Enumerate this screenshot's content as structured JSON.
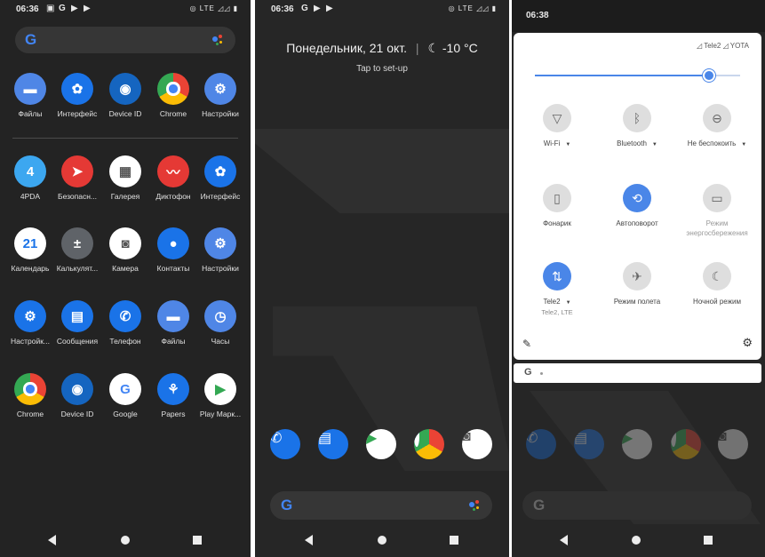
{
  "screen1": {
    "time": "06:36",
    "status_right": "LTE",
    "rows": [
      [
        {
          "label": "Файлы",
          "icon": "files-icon",
          "color": "#4f86e6"
        },
        {
          "label": "Интерфейс",
          "icon": "interface-icon",
          "color": "#1a73e8"
        },
        {
          "label": "Device ID",
          "icon": "device-id-icon",
          "color": "#1565c0"
        },
        {
          "label": "Chrome",
          "icon": "chrome-icon",
          "color": "#ffffff"
        },
        {
          "label": "Настройки",
          "icon": "settings-icon",
          "color": "#4f86e6"
        }
      ],
      [
        {
          "label": "4PDA",
          "icon": "4pda-icon",
          "color": "#3ca7f0"
        },
        {
          "label": "Безопасн...",
          "icon": "security-icon",
          "color": "#e53935"
        },
        {
          "label": "Галерея",
          "icon": "gallery-icon",
          "color": "#ffffff"
        },
        {
          "label": "Диктофон",
          "icon": "recorder-icon",
          "color": "#e53935"
        },
        {
          "label": "Интерфейс",
          "icon": "interface-icon",
          "color": "#1a73e8"
        }
      ],
      [
        {
          "label": "Календарь",
          "icon": "calendar-icon",
          "color": "#ffffff"
        },
        {
          "label": "Калькулят...",
          "icon": "calculator-icon",
          "color": "#5f6368"
        },
        {
          "label": "Камера",
          "icon": "camera-icon",
          "color": "#ffffff"
        },
        {
          "label": "Контакты",
          "icon": "contacts-icon",
          "color": "#1a73e8"
        },
        {
          "label": "Настройки",
          "icon": "settings-icon",
          "color": "#4f86e6"
        }
      ],
      [
        {
          "label": "Настройк...",
          "icon": "settings-icon",
          "color": "#1a73e8"
        },
        {
          "label": "Сообщения",
          "icon": "messages-icon",
          "color": "#1a73e8"
        },
        {
          "label": "Телефон",
          "icon": "phone-icon",
          "color": "#1a73e8"
        },
        {
          "label": "Файлы",
          "icon": "files-icon",
          "color": "#4f86e6"
        },
        {
          "label": "Часы",
          "icon": "clock-icon",
          "color": "#4f86e6"
        }
      ],
      [
        {
          "label": "Chrome",
          "icon": "chrome-icon",
          "color": "#ffffff"
        },
        {
          "label": "Device ID",
          "icon": "device-id-icon",
          "color": "#1565c0"
        },
        {
          "label": "Google",
          "icon": "google-icon",
          "color": "#ffffff"
        },
        {
          "label": "Papers",
          "icon": "papers-icon",
          "color": "#1a73e8"
        },
        {
          "label": "Play Марк...",
          "icon": "play-store-icon",
          "color": "#ffffff"
        }
      ]
    ]
  },
  "screen2": {
    "time": "06:36",
    "status_right": "LTE",
    "date": "Понедельник, 21 окт.",
    "weather": "-10 °C",
    "setup": "Tap to set-up",
    "dock": [
      {
        "icon": "phone-icon",
        "color": "#1a73e8"
      },
      {
        "icon": "messages-icon",
        "color": "#1a73e8"
      },
      {
        "icon": "play-store-icon",
        "color": "#ffffff"
      },
      {
        "icon": "chrome-icon",
        "color": "#ffffff"
      },
      {
        "icon": "camera-icon",
        "color": "#ffffff"
      }
    ]
  },
  "screen3": {
    "time": "06:38",
    "carriers": "◿ Tele2  ◿ YOTA",
    "brightness": 0.85,
    "tiles": [
      {
        "label": "Wi-Fi",
        "sub": "",
        "dropdown": true,
        "active": false,
        "icon": "wifi-icon",
        "glyph": "▽"
      },
      {
        "label": "Bluetooth",
        "sub": "",
        "dropdown": true,
        "active": false,
        "icon": "bluetooth-icon",
        "glyph": "ᛒ"
      },
      {
        "label": "Не беспокоить",
        "sub": "",
        "dropdown": true,
        "active": false,
        "icon": "dnd-icon",
        "glyph": "⊖"
      },
      {
        "label": "Фонарик",
        "sub": "",
        "dropdown": false,
        "active": false,
        "icon": "flashlight-icon",
        "glyph": "▯"
      },
      {
        "label": "Автоповорот",
        "sub": "",
        "dropdown": false,
        "active": true,
        "icon": "autorotate-icon",
        "glyph": "⟲"
      },
      {
        "label": "Режим энергосбережения",
        "sub": "",
        "dropdown": false,
        "active": false,
        "icon": "battery-saver-icon",
        "glyph": "▭"
      },
      {
        "label": "Tele2",
        "sub": "Tele2, LTE",
        "dropdown": true,
        "active": true,
        "icon": "mobile-data-icon",
        "glyph": "⇅"
      },
      {
        "label": "Режим полета",
        "sub": "",
        "dropdown": false,
        "active": false,
        "icon": "airplane-icon",
        "glyph": "✈"
      },
      {
        "label": "Ночной режим",
        "sub": "",
        "dropdown": false,
        "active": false,
        "icon": "night-mode-icon",
        "glyph": "☾"
      }
    ]
  },
  "colors": {
    "accent": "#4a86e8",
    "bg": "#262626",
    "panel": "#ffffff"
  }
}
